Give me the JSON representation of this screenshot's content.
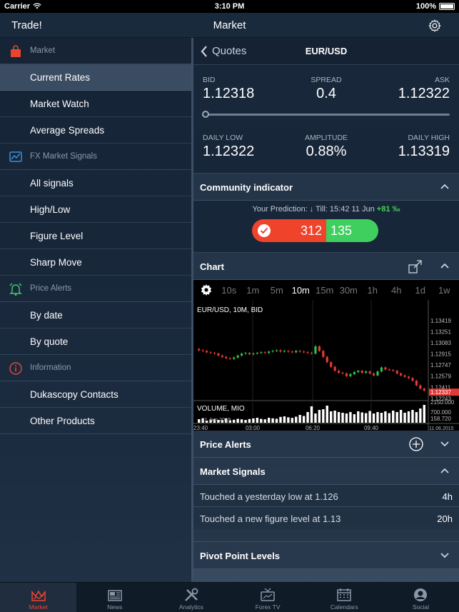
{
  "status_bar": {
    "carrier": "Carrier",
    "time": "3:10 PM",
    "battery": "100%"
  },
  "navbar": {
    "left_title": "Trade!",
    "center_title": "Market",
    "settings_icon": "gear-icon"
  },
  "sidebar": {
    "sections": [
      {
        "label": "Market",
        "icon": "shopping-bag-icon",
        "icon_color": "#e8452f",
        "items": [
          {
            "label": "Current Rates",
            "selected": true
          },
          {
            "label": "Market Watch"
          },
          {
            "label": "Average Spreads"
          }
        ]
      },
      {
        "label": "FX Market Signals",
        "icon": "signal-chart-icon",
        "icon_color": "#3a8fd9",
        "items": [
          {
            "label": "All signals"
          },
          {
            "label": "High/Low"
          },
          {
            "label": "Figure Level"
          },
          {
            "label": "Sharp Move"
          }
        ]
      },
      {
        "label": "Price Alerts",
        "icon": "alarm-bell-icon",
        "icon_color": "#45c26a",
        "items": [
          {
            "label": "By date"
          },
          {
            "label": "By quote"
          }
        ]
      },
      {
        "label": "Information",
        "icon": "info-icon",
        "icon_color": "#e8452f",
        "items": [
          {
            "label": "Dukascopy Contacts"
          },
          {
            "label": "Other Products"
          }
        ]
      }
    ]
  },
  "quotes_bar": {
    "back_label": "Quotes",
    "pair": "EUR/USD"
  },
  "rates": {
    "bid_label": "BID",
    "bid": "1.12318",
    "spread_label": "SPREAD",
    "spread": "0.4",
    "ask_label": "ASK",
    "ask": "1.12322",
    "daily_low_label": "DAILY LOW",
    "daily_low": "1.12322",
    "amplitude_label": "AMPLITUDE",
    "amplitude": "0.88%",
    "daily_high_label": "DAILY HIGH",
    "daily_high": "1.13319"
  },
  "community": {
    "title": "Community indicator",
    "prediction_prefix": "Your Prediction: ↓  Till: 15:42 11 Jun ",
    "prediction_change": "+81 ‰",
    "sell_votes": "312",
    "buy_votes": "135"
  },
  "chart": {
    "title": "Chart",
    "timeframes": [
      "10s",
      "1m",
      "5m",
      "10m",
      "15m",
      "30m",
      "1h",
      "4h",
      "1d",
      "1w"
    ],
    "active_timeframe": "10m"
  },
  "chart_data": {
    "type": "candlestick",
    "title": "EUR/USD, 10M, BID",
    "y_ticks": [
      "1.13419",
      "1.13251",
      "1.13083",
      "1.12915",
      "1.12747",
      "1.12579",
      "1.12411",
      "1.12243"
    ],
    "last_price": "1.12337",
    "ylim": [
      1.1222,
      1.1345
    ],
    "x_ticks": [
      "23:40",
      "03:00",
      "06:20",
      "09:40",
      "11.06.2015"
    ],
    "closes": [
      1.1297,
      1.1296,
      1.1294,
      1.1293,
      1.1292,
      1.1289,
      1.1287,
      1.1285,
      1.1284,
      1.1286,
      1.1289,
      1.1292,
      1.1293,
      1.1291,
      1.1292,
      1.1293,
      1.1294,
      1.1293,
      1.1295,
      1.1296,
      1.1297,
      1.1295,
      1.1296,
      1.1295,
      1.1294,
      1.1296,
      1.1295,
      1.1294,
      1.1293,
      1.1292,
      1.1303,
      1.1296,
      1.1287,
      1.1279,
      1.1272,
      1.1266,
      1.1263,
      1.1262,
      1.1258,
      1.1261,
      1.1264,
      1.1266,
      1.1263,
      1.1265,
      1.1262,
      1.1259,
      1.1265,
      1.1271,
      1.1268,
      1.1267,
      1.1266,
      1.1262,
      1.1259,
      1.1257,
      1.1255,
      1.1251,
      1.1244,
      1.1239,
      1.1236
    ],
    "volume_label": "VOLUME, MIO",
    "volume_ticks": [
      "2150.000",
      "700.000",
      "158.720"
    ],
    "volume_date_label": "11 Jun 2015",
    "volumes": [
      500,
      620,
      300,
      450,
      520,
      400,
      380,
      600,
      350,
      420,
      550,
      480,
      390,
      520,
      610,
      700,
      540,
      480,
      700,
      620,
      560,
      820,
      900,
      760,
      680,
      850,
      1100,
      950,
      1500,
      2300,
      1300,
      1800,
      1900,
      2400,
      1600,
      1700,
      1500,
      1400,
      1300,
      1500,
      1200,
      1600,
      1450,
      1350,
      1650,
      1300,
      1500,
      1400,
      1600,
      1350,
      1700,
      1500,
      1800,
      1400,
      1600,
      1800,
      1500,
      2000,
      2500
    ]
  },
  "price_alerts": {
    "title": "Price Alerts"
  },
  "market_signals": {
    "title": "Market Signals",
    "rows": [
      {
        "text": "Touched a yesterday low  at 1.126",
        "age": "4h"
      },
      {
        "text": "Touched a new figure level at 1.13",
        "age": "20h"
      }
    ]
  },
  "pivot": {
    "title": "Pivot Point Levels"
  },
  "tabbar": {
    "tabs": [
      {
        "label": "Market",
        "icon": "crown-chart-icon",
        "active": true
      },
      {
        "label": "News",
        "icon": "newspaper-icon"
      },
      {
        "label": "Analytics",
        "icon": "tools-icon"
      },
      {
        "label": "Forex TV",
        "icon": "tv-icon"
      },
      {
        "label": "Calendars",
        "icon": "calendar-icon"
      },
      {
        "label": "Social",
        "icon": "person-icon"
      }
    ]
  },
  "colors": {
    "accent_red": "#f0432c",
    "accent_green": "#3fcf5f",
    "candle_up": "#2ec04e",
    "candle_down": "#e53935"
  }
}
